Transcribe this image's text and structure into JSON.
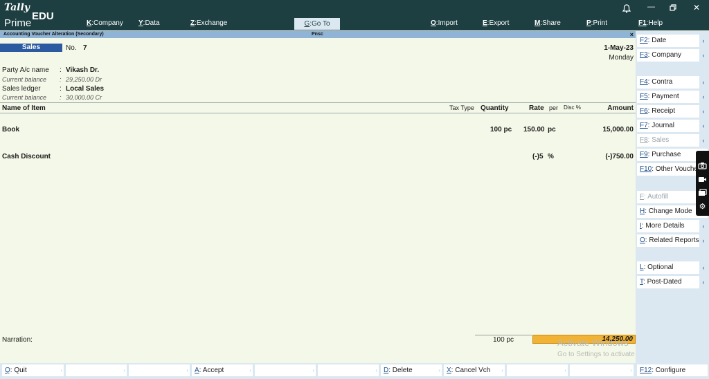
{
  "app": {
    "tally": "Tally",
    "edu": "EDU",
    "prime": "Prime"
  },
  "topmenu": [
    {
      "key": "K",
      "label": "Company"
    },
    {
      "key": "Y",
      "label": "Data"
    },
    {
      "key": "Z",
      "label": "Exchange"
    },
    {
      "key": "G",
      "label": "Go To"
    },
    {
      "key": "O",
      "label": "Import"
    },
    {
      "key": "E",
      "label": "Export"
    },
    {
      "key": "M",
      "label": "Share"
    },
    {
      "key": "P",
      "label": "Print"
    },
    {
      "key": "F1",
      "label": "Help"
    }
  ],
  "titlebar": {
    "left": "Accounting Voucher Alteration (Secondary)",
    "center": "Pnsc",
    "close": "×"
  },
  "voucher": {
    "type": "Sales",
    "no_label": "No.",
    "no_value": "7",
    "date": "1-May-23",
    "day": "Monday",
    "party_label": "Party A/c name",
    "party_value": "Vikash Dr.",
    "cur_bal_label": "Current balance",
    "party_balance": "29,250.00 Dr",
    "ledger_label": "Sales ledger",
    "ledger_value": "Local Sales",
    "ledger_balance": "30,000.00 Cr",
    "colon": ":"
  },
  "columns": {
    "name": "Name of Item",
    "tax": "Tax Type",
    "qty": "Quantity",
    "rate": "Rate",
    "per": "per",
    "disc": "Disc %",
    "amount": "Amount"
  },
  "items": [
    {
      "name": "Book",
      "qty": "100 pc",
      "rate": "150.00",
      "per": "pc",
      "amount": "15,000.00"
    },
    {
      "name": "Cash Discount",
      "qty": "",
      "rate": "(-)5",
      "per": "%",
      "amount": "(-)750.00"
    }
  ],
  "narration": {
    "label": "Narration:",
    "total_qty": "100 pc",
    "total_amount": "14,250.00"
  },
  "watermark": {
    "line1": "Activate Windows",
    "line2": "Go to Settings to activate Windows."
  },
  "rightpanel": [
    {
      "key": "F2",
      "label": "Date",
      "chev": true,
      "disabled": false
    },
    {
      "key": "F3",
      "label": "Company",
      "chev": true,
      "disabled": false
    },
    {
      "key": "F4",
      "label": "Contra",
      "chev": true,
      "disabled": false
    },
    {
      "key": "F5",
      "label": "Payment",
      "chev": true,
      "disabled": false
    },
    {
      "key": "F6",
      "label": "Receipt",
      "chev": true,
      "disabled": false
    },
    {
      "key": "F7",
      "label": "Journal",
      "chev": true,
      "disabled": false
    },
    {
      "key": "F8",
      "label": "Sales",
      "chev": true,
      "disabled": true
    },
    {
      "key": "F9",
      "label": "Purchase",
      "chev": true,
      "disabled": false
    },
    {
      "key": "F10",
      "label": "Other Vouchers",
      "chev": false,
      "disabled": false
    },
    {
      "key": "F",
      "label": "Autofill",
      "chev": true,
      "disabled": true
    },
    {
      "key": "H",
      "label": "Change Mode",
      "chev": true,
      "disabled": false
    },
    {
      "key": "I",
      "label": "More Details",
      "chev": true,
      "disabled": false
    },
    {
      "key": "O",
      "label": "Related Reports",
      "chev": true,
      "disabled": false
    },
    {
      "key": "L",
      "label": "Optional",
      "chev": true,
      "disabled": false
    },
    {
      "key": "T",
      "label": "Post-Dated",
      "chev": true,
      "disabled": false
    }
  ],
  "bottombar": [
    {
      "key": "Q",
      "label": "Quit"
    },
    {
      "key": "",
      "label": ""
    },
    {
      "key": "",
      "label": ""
    },
    {
      "key": "A",
      "label": "Accept"
    },
    {
      "key": "",
      "label": ""
    },
    {
      "key": "",
      "label": ""
    },
    {
      "key": "D",
      "label": "Delete"
    },
    {
      "key": "X",
      "label": "Cancel Vch"
    },
    {
      "key": "",
      "label": ""
    },
    {
      "key": "",
      "label": ""
    }
  ],
  "configure": {
    "key": "F12",
    "label": "Configure"
  },
  "icons": {
    "bell": "bell-icon",
    "minimize": "minimize-icon",
    "restore": "restore-icon",
    "close": "close-icon"
  }
}
